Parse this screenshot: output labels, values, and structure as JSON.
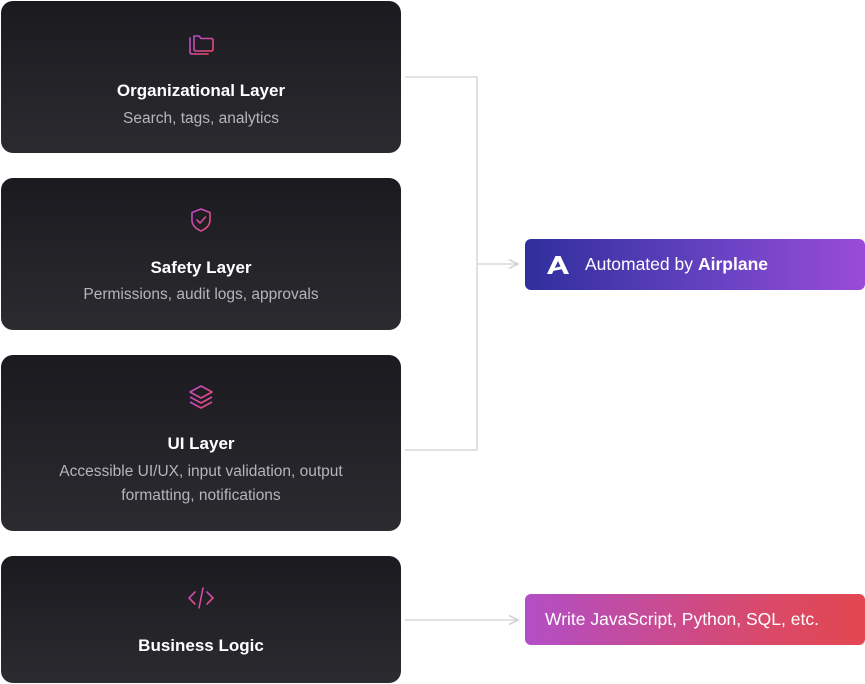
{
  "layers": [
    {
      "icon": "folders-icon",
      "title": "Organizational Layer",
      "description": "Search, tags, analytics"
    },
    {
      "icon": "shield-check-icon",
      "title": "Safety Layer",
      "description": "Permissions, audit logs, approvals"
    },
    {
      "icon": "layers-stack-icon",
      "title": "UI Layer",
      "description": "Accessible UI/UX, input validation, output formatting, notifications"
    },
    {
      "icon": "code-icon",
      "title": "Business Logic",
      "description": ""
    }
  ],
  "automated": {
    "icon": "airplane-logo-icon",
    "prefix": "Automated by",
    "brand": "Airplane"
  },
  "code_pill": {
    "label": "Write JavaScript, Python, SQL, etc."
  },
  "colors": {
    "card_top": "#1a1a1f",
    "card_bottom": "#2b2b30",
    "icon_pink": "#e0457b",
    "connector": "#d8d8dc",
    "automated_gradient_start": "#2f2f9c",
    "automated_gradient_end": "#9a4bd8",
    "code_gradient_start": "#b24ec6",
    "code_gradient_end": "#e2484f"
  }
}
